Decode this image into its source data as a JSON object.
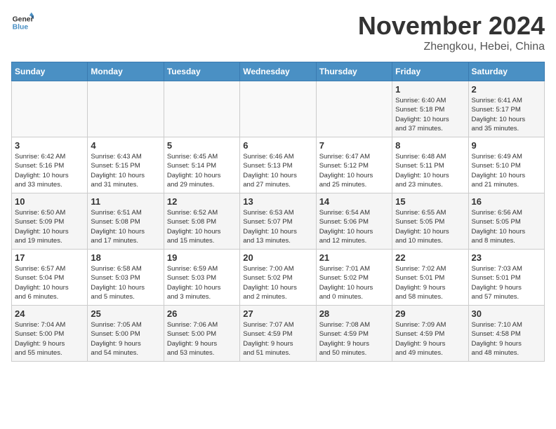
{
  "header": {
    "logo_line1": "General",
    "logo_line2": "Blue",
    "month": "November 2024",
    "location": "Zhengkou, Hebei, China"
  },
  "days_of_week": [
    "Sunday",
    "Monday",
    "Tuesday",
    "Wednesday",
    "Thursday",
    "Friday",
    "Saturday"
  ],
  "weeks": [
    [
      {
        "day": "",
        "info": ""
      },
      {
        "day": "",
        "info": ""
      },
      {
        "day": "",
        "info": ""
      },
      {
        "day": "",
        "info": ""
      },
      {
        "day": "",
        "info": ""
      },
      {
        "day": "1",
        "info": "Sunrise: 6:40 AM\nSunset: 5:18 PM\nDaylight: 10 hours\nand 37 minutes."
      },
      {
        "day": "2",
        "info": "Sunrise: 6:41 AM\nSunset: 5:17 PM\nDaylight: 10 hours\nand 35 minutes."
      }
    ],
    [
      {
        "day": "3",
        "info": "Sunrise: 6:42 AM\nSunset: 5:16 PM\nDaylight: 10 hours\nand 33 minutes."
      },
      {
        "day": "4",
        "info": "Sunrise: 6:43 AM\nSunset: 5:15 PM\nDaylight: 10 hours\nand 31 minutes."
      },
      {
        "day": "5",
        "info": "Sunrise: 6:45 AM\nSunset: 5:14 PM\nDaylight: 10 hours\nand 29 minutes."
      },
      {
        "day": "6",
        "info": "Sunrise: 6:46 AM\nSunset: 5:13 PM\nDaylight: 10 hours\nand 27 minutes."
      },
      {
        "day": "7",
        "info": "Sunrise: 6:47 AM\nSunset: 5:12 PM\nDaylight: 10 hours\nand 25 minutes."
      },
      {
        "day": "8",
        "info": "Sunrise: 6:48 AM\nSunset: 5:11 PM\nDaylight: 10 hours\nand 23 minutes."
      },
      {
        "day": "9",
        "info": "Sunrise: 6:49 AM\nSunset: 5:10 PM\nDaylight: 10 hours\nand 21 minutes."
      }
    ],
    [
      {
        "day": "10",
        "info": "Sunrise: 6:50 AM\nSunset: 5:09 PM\nDaylight: 10 hours\nand 19 minutes."
      },
      {
        "day": "11",
        "info": "Sunrise: 6:51 AM\nSunset: 5:08 PM\nDaylight: 10 hours\nand 17 minutes."
      },
      {
        "day": "12",
        "info": "Sunrise: 6:52 AM\nSunset: 5:08 PM\nDaylight: 10 hours\nand 15 minutes."
      },
      {
        "day": "13",
        "info": "Sunrise: 6:53 AM\nSunset: 5:07 PM\nDaylight: 10 hours\nand 13 minutes."
      },
      {
        "day": "14",
        "info": "Sunrise: 6:54 AM\nSunset: 5:06 PM\nDaylight: 10 hours\nand 12 minutes."
      },
      {
        "day": "15",
        "info": "Sunrise: 6:55 AM\nSunset: 5:05 PM\nDaylight: 10 hours\nand 10 minutes."
      },
      {
        "day": "16",
        "info": "Sunrise: 6:56 AM\nSunset: 5:05 PM\nDaylight: 10 hours\nand 8 minutes."
      }
    ],
    [
      {
        "day": "17",
        "info": "Sunrise: 6:57 AM\nSunset: 5:04 PM\nDaylight: 10 hours\nand 6 minutes."
      },
      {
        "day": "18",
        "info": "Sunrise: 6:58 AM\nSunset: 5:03 PM\nDaylight: 10 hours\nand 5 minutes."
      },
      {
        "day": "19",
        "info": "Sunrise: 6:59 AM\nSunset: 5:03 PM\nDaylight: 10 hours\nand 3 minutes."
      },
      {
        "day": "20",
        "info": "Sunrise: 7:00 AM\nSunset: 5:02 PM\nDaylight: 10 hours\nand 2 minutes."
      },
      {
        "day": "21",
        "info": "Sunrise: 7:01 AM\nSunset: 5:02 PM\nDaylight: 10 hours\nand 0 minutes."
      },
      {
        "day": "22",
        "info": "Sunrise: 7:02 AM\nSunset: 5:01 PM\nDaylight: 9 hours\nand 58 minutes."
      },
      {
        "day": "23",
        "info": "Sunrise: 7:03 AM\nSunset: 5:01 PM\nDaylight: 9 hours\nand 57 minutes."
      }
    ],
    [
      {
        "day": "24",
        "info": "Sunrise: 7:04 AM\nSunset: 5:00 PM\nDaylight: 9 hours\nand 55 minutes."
      },
      {
        "day": "25",
        "info": "Sunrise: 7:05 AM\nSunset: 5:00 PM\nDaylight: 9 hours\nand 54 minutes."
      },
      {
        "day": "26",
        "info": "Sunrise: 7:06 AM\nSunset: 5:00 PM\nDaylight: 9 hours\nand 53 minutes."
      },
      {
        "day": "27",
        "info": "Sunrise: 7:07 AM\nSunset: 4:59 PM\nDaylight: 9 hours\nand 51 minutes."
      },
      {
        "day": "28",
        "info": "Sunrise: 7:08 AM\nSunset: 4:59 PM\nDaylight: 9 hours\nand 50 minutes."
      },
      {
        "day": "29",
        "info": "Sunrise: 7:09 AM\nSunset: 4:59 PM\nDaylight: 9 hours\nand 49 minutes."
      },
      {
        "day": "30",
        "info": "Sunrise: 7:10 AM\nSunset: 4:58 PM\nDaylight: 9 hours\nand 48 minutes."
      }
    ]
  ]
}
